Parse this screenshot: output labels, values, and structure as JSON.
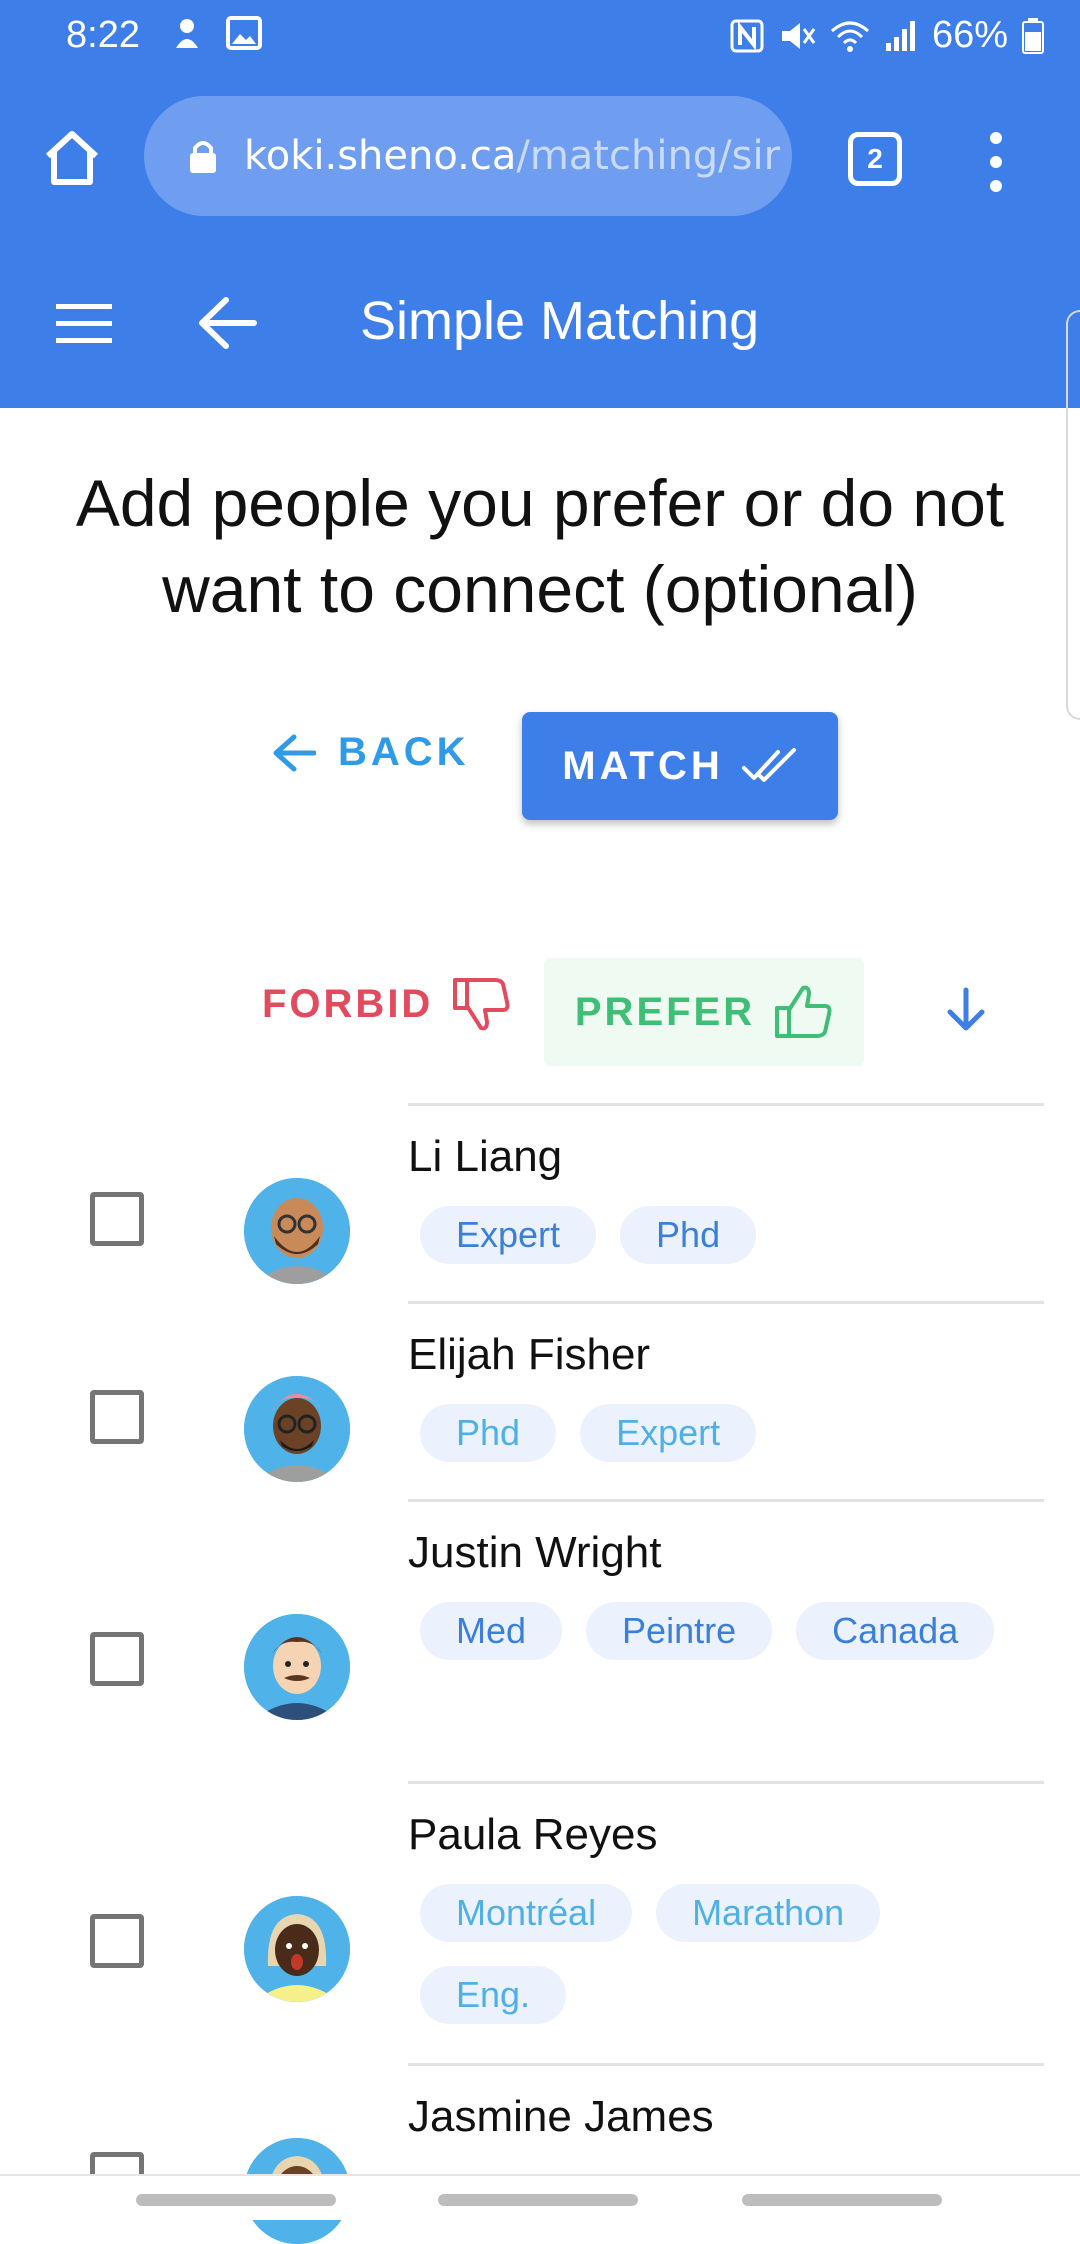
{
  "status_bar": {
    "time": "8:22",
    "battery": "66%"
  },
  "browser": {
    "url_host": "koki.sheno.ca",
    "url_path": "/matching/sir",
    "tab_count": "2"
  },
  "app_bar": {
    "title": "Simple Matching"
  },
  "page": {
    "heading": "Add people you prefer or do not want to connect (optional)",
    "back_label": "BACK",
    "match_label": "MATCH"
  },
  "filters": {
    "forbid_label": "FORBID",
    "prefer_label": "PREFER"
  },
  "people": [
    {
      "name": "Li Liang",
      "tags": [
        "Expert",
        "Phd"
      ]
    },
    {
      "name": "Elijah Fisher",
      "tags": [
        "Phd",
        "Expert"
      ]
    },
    {
      "name": "Justin Wright",
      "tags": [
        "Med",
        "Peintre",
        "Canada"
      ]
    },
    {
      "name": "Paula Reyes",
      "tags": [
        "Montréal",
        "Marathon",
        "Eng."
      ]
    },
    {
      "name": "Jasmine James",
      "tags": []
    }
  ],
  "colors": {
    "primary": "#3d7ee9",
    "forbid": "#e24a5e",
    "prefer": "#3fbf76",
    "link": "#2f9ae8"
  }
}
